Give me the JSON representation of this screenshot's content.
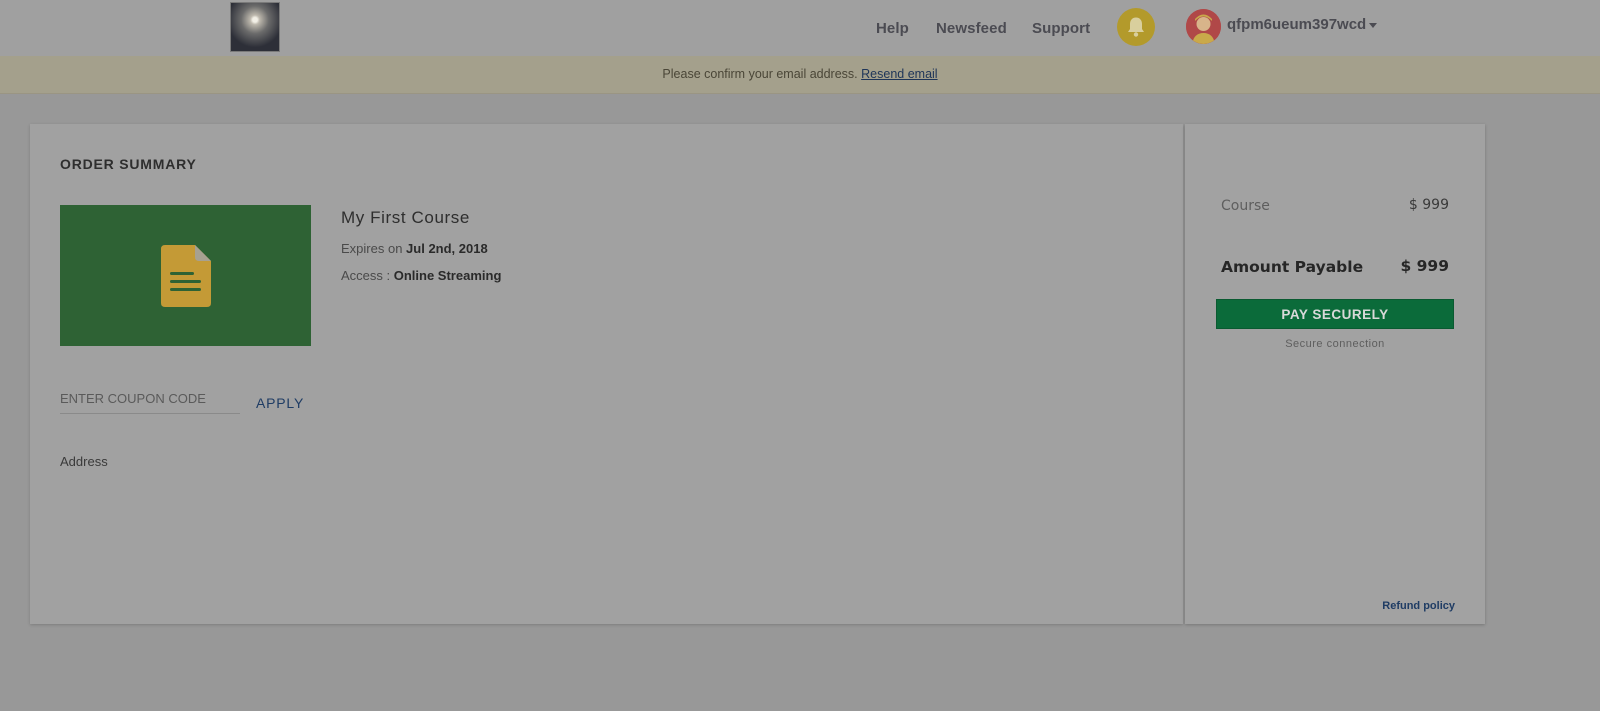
{
  "nav": {
    "links": [
      "Help",
      "Newsfeed",
      "Support"
    ],
    "username": "qfpm6ueum397wcd"
  },
  "banner": {
    "message": "Please confirm your email address.",
    "link": "Resend email"
  },
  "order": {
    "title": "ORDER SUMMARY",
    "course_name": "My First Course",
    "expires_label": "Expires on",
    "expires_value": "Jul 2nd, 2018",
    "access_label": "Access :",
    "access_value": "Online Streaming",
    "coupon_placeholder": "ENTER COUPON CODE",
    "apply_label": "APPLY",
    "address_label": "Address"
  },
  "payment": {
    "course_label": "Course",
    "course_price": "$ 999",
    "payable_label": "Amount Payable",
    "payable_price": "$ 999",
    "pay_button": "PAY SECURELY",
    "secure_text": "Secure connection",
    "refund_link": "Refund policy"
  },
  "colors": {
    "pay_button": "#0b6b3a",
    "thumbnail_bg": "#2e6234",
    "document_icon": "#c49a36",
    "link": "#1f3c64",
    "bell": "#b39a2b"
  },
  "icons": {
    "logo": "rocket-launch-logo",
    "notifications": "bell-icon",
    "course": "document-icon",
    "menu": "caret-down-icon"
  }
}
